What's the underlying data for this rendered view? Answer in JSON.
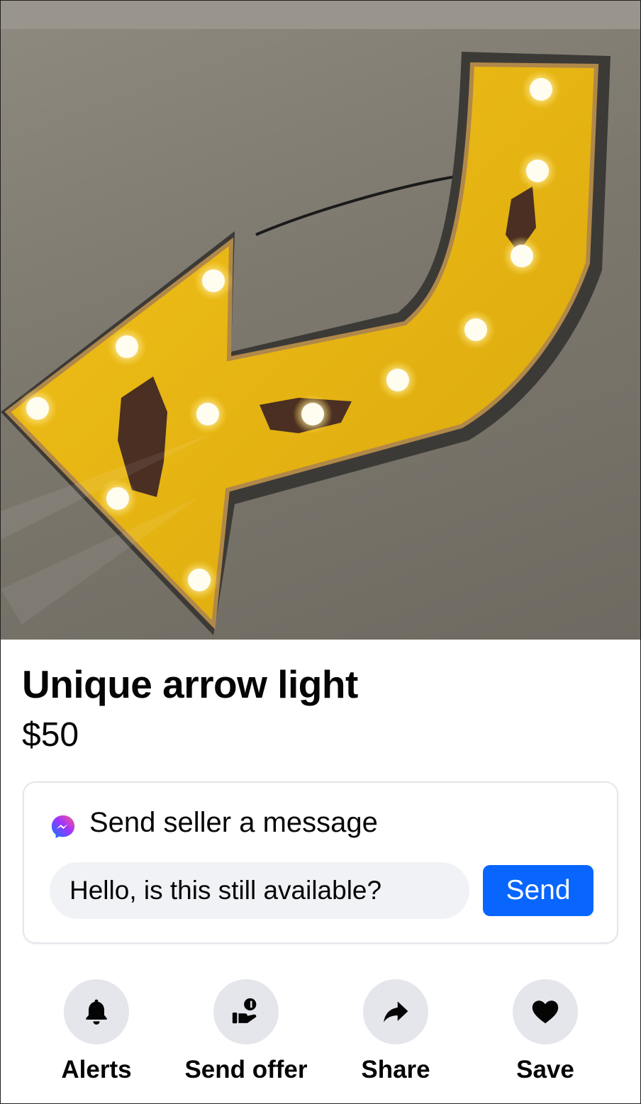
{
  "listing": {
    "title": "Unique arrow light",
    "price": "$50",
    "photo_icon": "arrow-marquee-light-photo"
  },
  "message": {
    "header_label": "Send seller a message",
    "header_icon": "messenger-icon",
    "input_value": "Hello, is this still available?",
    "send_label": "Send",
    "send_color": "#0866ff"
  },
  "actions": [
    {
      "label": "Alerts",
      "icon": "bell-icon"
    },
    {
      "label": "Send offer",
      "icon": "offer-hand-icon"
    },
    {
      "label": "Share",
      "icon": "share-arrow-icon"
    },
    {
      "label": "Save",
      "icon": "heart-icon"
    }
  ]
}
